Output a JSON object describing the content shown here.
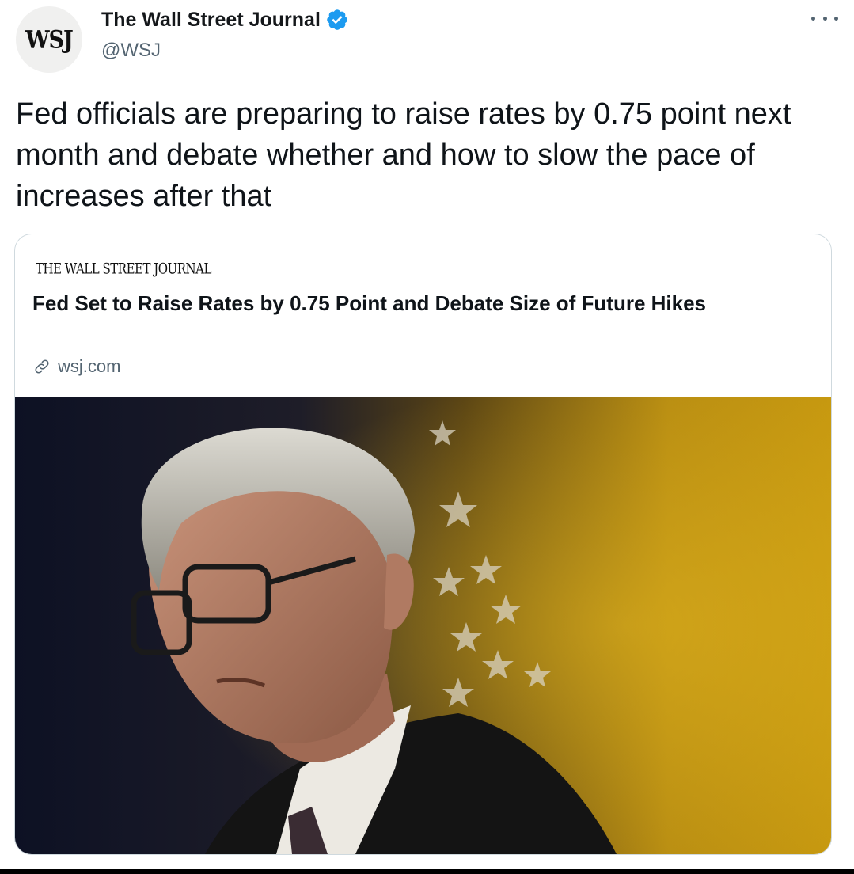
{
  "tweet": {
    "avatar_text": "WSJ",
    "display_name": "The Wall Street Journal",
    "handle": "@WSJ",
    "verified": true,
    "text": "Fed officials are preparing to raise rates by 0.75 point next month and debate whether and how to slow the pace of increases after that"
  },
  "card": {
    "masthead": "THE WALL STREET JOURNAL",
    "title": "Fed Set to Raise Rates by 0.75 Point and Debate Size of Future Hikes",
    "domain": "wsj.com",
    "link_icon": "link-icon"
  },
  "icons": {
    "verified": "verified-badge-icon",
    "more": "more-options-icon"
  },
  "colors": {
    "verified_blue": "#1d9bf0",
    "secondary_text": "#536471",
    "card_border": "#cfd9de"
  }
}
